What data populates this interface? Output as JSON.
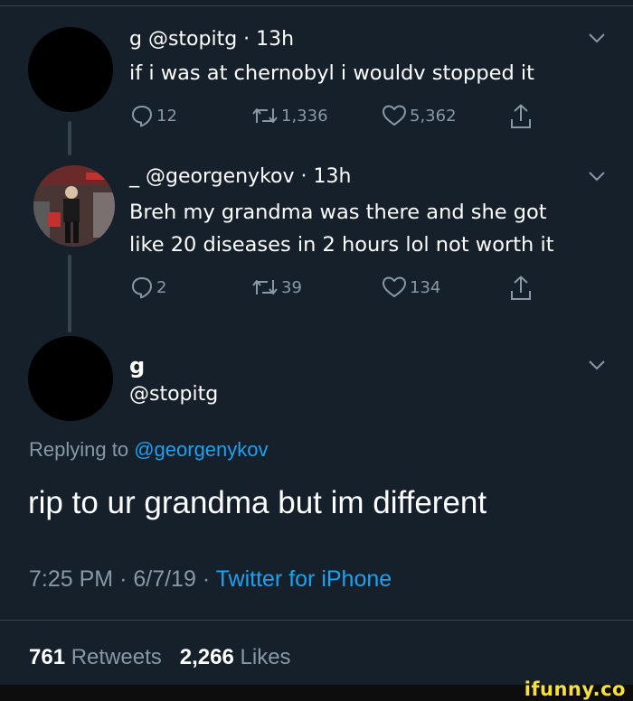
{
  "tweets": [
    {
      "name": "g",
      "handle": "@stopitg",
      "time": "13h",
      "text": "if i was at chernobyl i wouldv stopped it",
      "replies": "12",
      "retweets": "1,336",
      "likes": "5,362"
    },
    {
      "name": "_",
      "handle": "@georgenykov",
      "time": "13h",
      "text_line1": "Breh my grandma was there and she got",
      "text_line2": "like 20 diseases in 2 hours lol not worth it",
      "replies": "2",
      "retweets": "39",
      "likes": "134"
    }
  ],
  "main": {
    "name": "g",
    "handle": "@stopitg",
    "replying_prefix": "Replying to",
    "replying_to": "@georgenykov",
    "text": "rip to ur grandma but im different",
    "time": "7:25 PM",
    "date": "6/7/19",
    "client": "Twitter for iPhone",
    "separator": "·",
    "retweet_count": "761",
    "retweet_label": "Retweets",
    "like_count": "2,266",
    "like_label": "Likes"
  },
  "watermark": "ifunny.co",
  "colors": {
    "background": "#15202b",
    "secondary_text": "#8899a6",
    "link": "#1da1f2",
    "divider": "#38444d"
  },
  "icons": [
    "reply-icon",
    "retweet-icon",
    "like-icon",
    "share-icon",
    "chevron-down-icon"
  ]
}
